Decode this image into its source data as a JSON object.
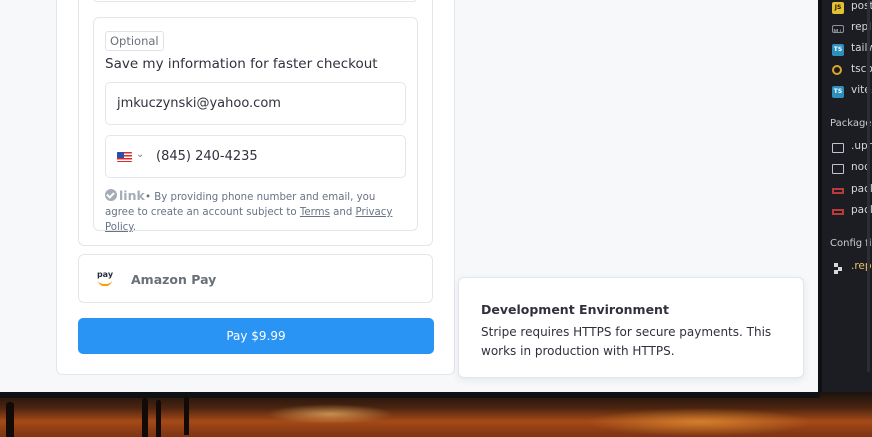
{
  "checkout": {
    "link_section": {
      "optional_badge": "Optional",
      "save_info_label": "Save my information for faster checkout",
      "email_value": "jmkuczynski@yahoo.com",
      "phone_value": "(845) 240-4235",
      "country_code": "US",
      "brand_label": "link",
      "disclaimer_prefix": "• By providing phone number and email, you agree to create an account subject to ",
      "terms_link": "Terms",
      "disclaimer_and": " and ",
      "privacy_link": "Privacy Policy",
      "disclaimer_suffix": "."
    },
    "amazon_pay": {
      "icon_text": "pay",
      "label": "Amazon Pay"
    },
    "pay_button_label": "Pay $9.99"
  },
  "toast": {
    "title": "Development Environment",
    "description": "Stripe requires HTTPS for secure payments. This works in production with HTTPS."
  },
  "ide": {
    "files": [
      {
        "name": "post",
        "icon": "js"
      },
      {
        "name": "repl",
        "icon": "md"
      },
      {
        "name": "tailw",
        "icon": "ts"
      },
      {
        "name": "tsco",
        "icon": "ts-ring"
      },
      {
        "name": "vite.",
        "icon": "ts"
      }
    ],
    "packages_heading": "Package",
    "packages": [
      {
        "name": ".upr",
        "icon": "folder"
      },
      {
        "name": "nod",
        "icon": "folder"
      },
      {
        "name": "pacl",
        "icon": "pkg"
      },
      {
        "name": "pacl",
        "icon": "pkg"
      }
    ],
    "config_heading": "Config fil",
    "config_files": [
      {
        "name": ".rep",
        "icon": "cfg"
      }
    ]
  }
}
